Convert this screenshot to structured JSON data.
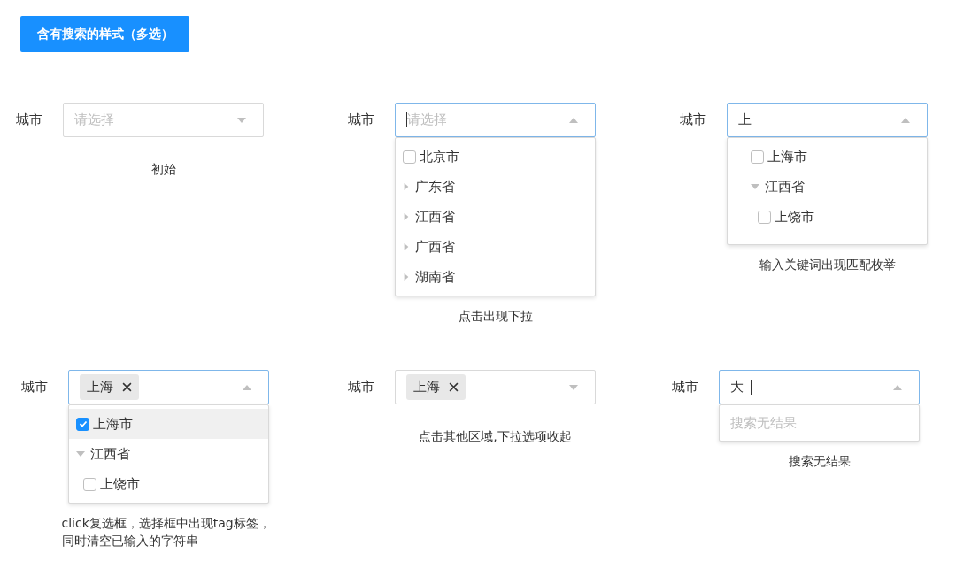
{
  "header_button": "含有搜索的样式（多选）",
  "panels": [
    {
      "label": "城市",
      "field": {
        "placeholder": "请选择",
        "focused": false,
        "cursor": false,
        "open": false
      },
      "caption": "初始"
    },
    {
      "label": "城市",
      "field": {
        "placeholder": "请选择",
        "focused": true,
        "cursor": true,
        "open": true
      },
      "dropdown": {
        "indented": false,
        "items": [
          {
            "kind": "checkbox",
            "text": "北京市",
            "checked": false,
            "selected": false
          },
          {
            "kind": "group",
            "text": "广东省",
            "expanded": false
          },
          {
            "kind": "group",
            "text": "江西省",
            "expanded": false
          },
          {
            "kind": "group",
            "text": "广西省",
            "expanded": false
          },
          {
            "kind": "group",
            "text": "湖南省",
            "expanded": false
          }
        ]
      },
      "caption": "点击出现下拉"
    },
    {
      "label": "城市",
      "field": {
        "value": "上",
        "focused": true,
        "cursor": true,
        "open": true
      },
      "dropdown": {
        "indented": true,
        "items": [
          {
            "kind": "checkbox",
            "text": "上海市",
            "checked": false,
            "selected": false
          },
          {
            "kind": "group",
            "text": "江西省",
            "expanded": true,
            "children": [
              {
                "kind": "checkbox",
                "text": "上饶市",
                "checked": false,
                "selected": false
              }
            ]
          }
        ]
      },
      "caption": "输入关键词出现匹配枚举"
    },
    {
      "label": "城市",
      "field": {
        "tags": [
          "上海"
        ],
        "focused": true,
        "cursor": false,
        "open": true
      },
      "dropdown": {
        "indented": false,
        "items": [
          {
            "kind": "checkbox",
            "text": "上海市",
            "checked": true,
            "selected": true
          },
          {
            "kind": "group",
            "text": "江西省",
            "expanded": true,
            "children": [
              {
                "kind": "checkbox",
                "text": "上饶市",
                "checked": false,
                "selected": false
              }
            ]
          }
        ]
      },
      "caption": "click复选框，选择框中出现tag标签，同时清空已输入的字符串"
    },
    {
      "label": "城市",
      "field": {
        "tags": [
          "上海"
        ],
        "focused": false,
        "cursor": false,
        "open": false
      },
      "caption": "点击其他区域,下拉选项收起"
    },
    {
      "label": "城市",
      "field": {
        "value": "大",
        "focused": true,
        "cursor": true,
        "open": true
      },
      "dropdown": {
        "empty_text": "搜索无结果"
      },
      "caption": "搜索无结果"
    }
  ]
}
